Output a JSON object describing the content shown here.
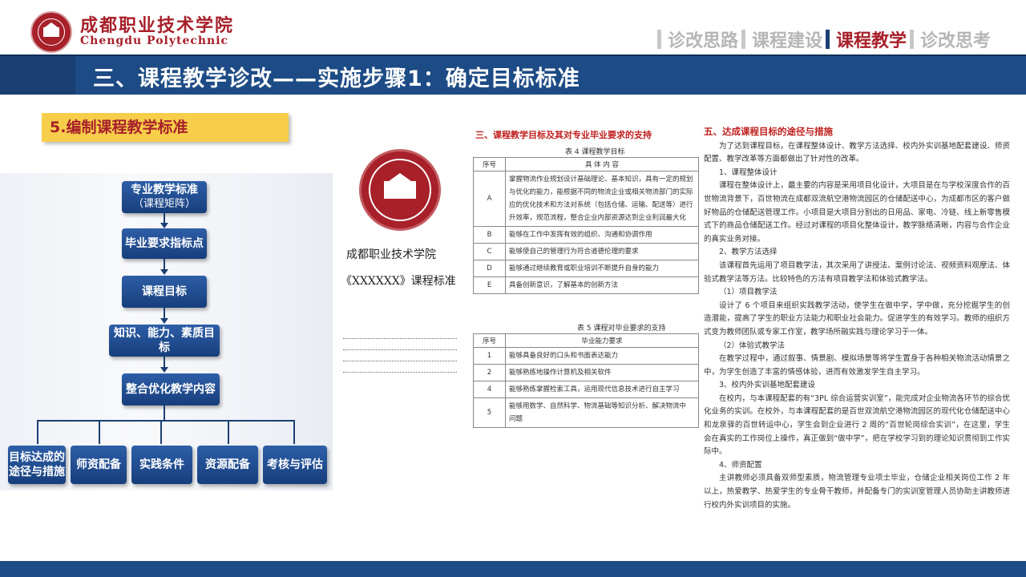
{
  "header": {
    "brand_cn": "成都职业技术学院",
    "brand_en": "Chengdu Polytechnic",
    "nav": [
      {
        "label": "诊改思路",
        "active": false
      },
      {
        "label": "课程建设",
        "active": false
      },
      {
        "label": "课程教学",
        "active": true
      },
      {
        "label": "诊改思考",
        "active": false
      }
    ]
  },
  "title": "三、课程教学诊改——实施步骤1：确定目标标准",
  "section_label": "5.编制课程教学标准",
  "flowchart": {
    "box1_line1": "专业教学标准",
    "box1_line2": "（课程矩阵）",
    "box2": "毕业要求指标点",
    "box3": "课程目标",
    "box4": "知识、能力、素质目标",
    "box5": "整合优化教学内容",
    "leaves": [
      {
        "line1": "目标达成的",
        "line2": "途径与措施"
      },
      {
        "line1": "师资配备",
        "line2": ""
      },
      {
        "line1": "实践条件",
        "line2": ""
      },
      {
        "line1": "资源配备",
        "line2": ""
      },
      {
        "line1": "考核与评估",
        "line2": ""
      }
    ]
  },
  "cover": {
    "school": "成都职业技术学院",
    "standard": "《XXXXXX》课程标准"
  },
  "doc_tables": {
    "heading": "三、课程教学目标及其对专业毕业要求的支持",
    "table4_caption": "表 4 课程教学目标",
    "table4_header": [
      "序号",
      "具 体 内 容"
    ],
    "table4_rows": [
      {
        "no": "A",
        "lines": [
          "掌握物流作业规划设计基础理论、基本知识，具有一定的规划",
          "与优化的能力，能根据不同的物流企业或相关物流部门的实际",
          "应的优化技术和方法对系统（包括仓储、运输、配送等）进行",
          "升效率，规范流程，整合企业内部资源达到企业利润最大化"
        ]
      },
      {
        "no": "B",
        "lines": [
          "能够在工作中发挥有效的组织、沟通和协调作用"
        ]
      },
      {
        "no": "C",
        "lines": [
          "能够使自己的管理行为符合道德伦理的要求"
        ]
      },
      {
        "no": "D",
        "lines": [
          "能够通过继续教育或职业培训不断提升自身的能力"
        ]
      },
      {
        "no": "E",
        "lines": [
          "具备创新意识，了解基本的创新方法"
        ]
      }
    ],
    "table5_caption": "表 5 课程对毕业要求的支持",
    "table5_header": [
      "序号",
      "毕业能力要求"
    ],
    "table5_rows": [
      {
        "no": "1",
        "lines": [
          "能够具备良好的口头和书面表达能力"
        ]
      },
      {
        "no": "2",
        "lines": [
          "能够熟练地操作计算机及相关软件"
        ]
      },
      {
        "no": "4",
        "lines": [
          "能够熟练掌握检索工具，运用现代信息技术进行自主学习"
        ]
      },
      {
        "no": "5",
        "lines": [
          "能够用数学、自然科学、物流基础等知识分析、解决物流中",
          "问题"
        ]
      }
    ]
  },
  "doc_text": {
    "heading": "五、达成课程目标的途径与措施",
    "paragraphs": [
      {
        "indent": true,
        "text": "为了达到课程目标，在课程整体设计、教学方法选择、校内外实训基地配套建设、师资配置、教学改革等方面都做出了针对性的改革。"
      },
      {
        "indent": true,
        "text": "1、课程整体设计"
      },
      {
        "indent": true,
        "text": "课程在整体设计上，最主要的内容是采用项目化设计，大项目是在与学校深度合作的百世物流背景下，百世物流在成都双流航空港物流园区的仓储配送中心，为成都市区的客户做好物品的仓储配送管理工作。小项目是大项目分割出的日用品、家电、冷链、线上新零售模式下的商品仓储配送工作。经过对课程的项目化整体设计，教学脉络清晰，内容与合作企业的真实业务对接。"
      },
      {
        "indent": true,
        "text": "2、教学方法选择"
      },
      {
        "indent": true,
        "text": "该课程首先运用了项目教学法，其次采用了讲授法、案例讨论法、视频资料观摩法、体验式教学法等方法。比较特色的方法有项目教学法和体验式教学法。"
      },
      {
        "indent": true,
        "text": "（1）项目教学法"
      },
      {
        "indent": true,
        "text": "设计了 6 个项目来组织实践教学活动，使学生在做中学，学中做，充分挖掘学生的创造潜能，提高了学生的职业方法能力和职业社会能力。促进学生的有效学习。教师的组织方式变为教师团队或专家工作室，教学场所融实践与理论学习于一体。"
      },
      {
        "indent": true,
        "text": "（2）体验式教学法"
      },
      {
        "indent": true,
        "text": "在教学过程中，通过叙事、情景剧、模拟场景等将学生置身于各种相关物流活动情景之中，为学生创造了丰富的情感体验，进而有效激发学生自主学习。"
      },
      {
        "indent": true,
        "text": "3、校内外实训基地配套建设"
      },
      {
        "indent": true,
        "text": "在校内，与本课程配套的有“3PL 综合运营实训室”，能完成对企业物流各环节的综合优化业务的实训。在校外，与本课程配套的是百世双流航空港物流园区的现代化仓储配送中心和龙泉驿的百世转运中心，学生会到企业进行 2 周的“百世轮岗综合实训”，在这里，学生会在真实的工作岗位上操作，真正做到“做中学”，把在学校学习到的理论知识贯彻到工作实际中。"
      },
      {
        "indent": true,
        "text": "4、师资配置"
      },
      {
        "indent": true,
        "text": "主讲教师必须具备双师型素质，物流管理专业项士毕业，仓储企业相关岗位工作 2 年以上，热爱教学、热爱学生的专业骨干教师，并配备专门的实训室管理人员协助主讲教师进行校内外实训项目的实施。"
      }
    ]
  },
  "colors": {
    "brand_red": "#a7202a",
    "band_blue": "#1d4b85",
    "label_yellow": "#f7ce49",
    "box_blue": "#1f4c8f"
  }
}
